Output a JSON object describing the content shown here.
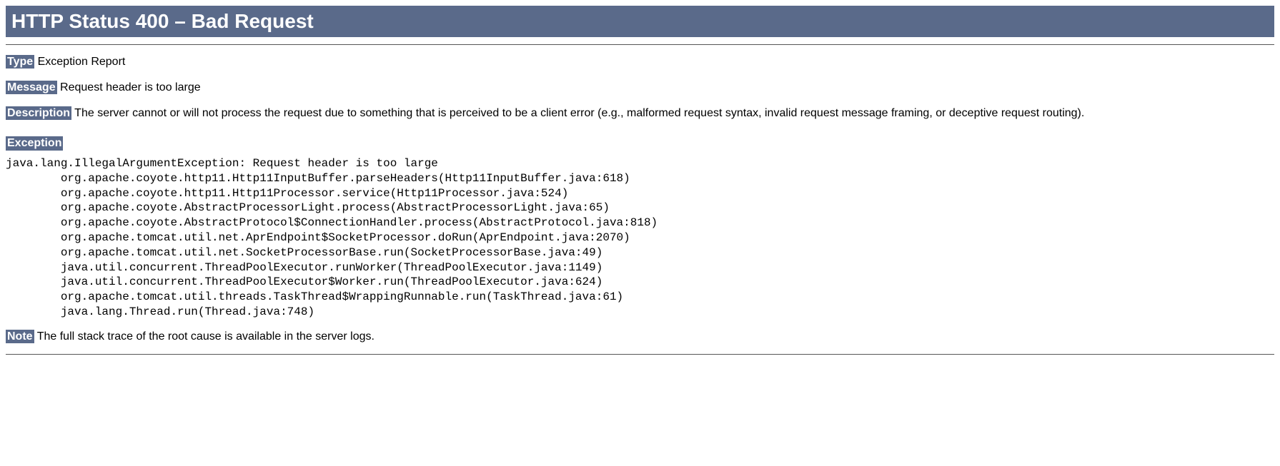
{
  "title": "HTTP Status 400 – Bad Request",
  "type": {
    "label": "Type",
    "value": "Exception Report"
  },
  "message": {
    "label": "Message",
    "value": "Request header is too large"
  },
  "description": {
    "label": "Description",
    "value": "The server cannot or will not process the request due to something that is perceived to be a client error (e.g., malformed request syntax, invalid request message framing, or deceptive request routing)."
  },
  "exception": {
    "label": "Exception",
    "stacktrace": "java.lang.IllegalArgumentException: Request header is too large\n        org.apache.coyote.http11.Http11InputBuffer.parseHeaders(Http11InputBuffer.java:618)\n        org.apache.coyote.http11.Http11Processor.service(Http11Processor.java:524)\n        org.apache.coyote.AbstractProcessorLight.process(AbstractProcessorLight.java:65)\n        org.apache.coyote.AbstractProtocol$ConnectionHandler.process(AbstractProtocol.java:818)\n        org.apache.tomcat.util.net.AprEndpoint$SocketProcessor.doRun(AprEndpoint.java:2070)\n        org.apache.tomcat.util.net.SocketProcessorBase.run(SocketProcessorBase.java:49)\n        java.util.concurrent.ThreadPoolExecutor.runWorker(ThreadPoolExecutor.java:1149)\n        java.util.concurrent.ThreadPoolExecutor$Worker.run(ThreadPoolExecutor.java:624)\n        org.apache.tomcat.util.threads.TaskThread$WrappingRunnable.run(TaskThread.java:61)\n        java.lang.Thread.run(Thread.java:748)"
  },
  "note": {
    "label": "Note",
    "value": "The full stack trace of the root cause is available in the server logs."
  }
}
